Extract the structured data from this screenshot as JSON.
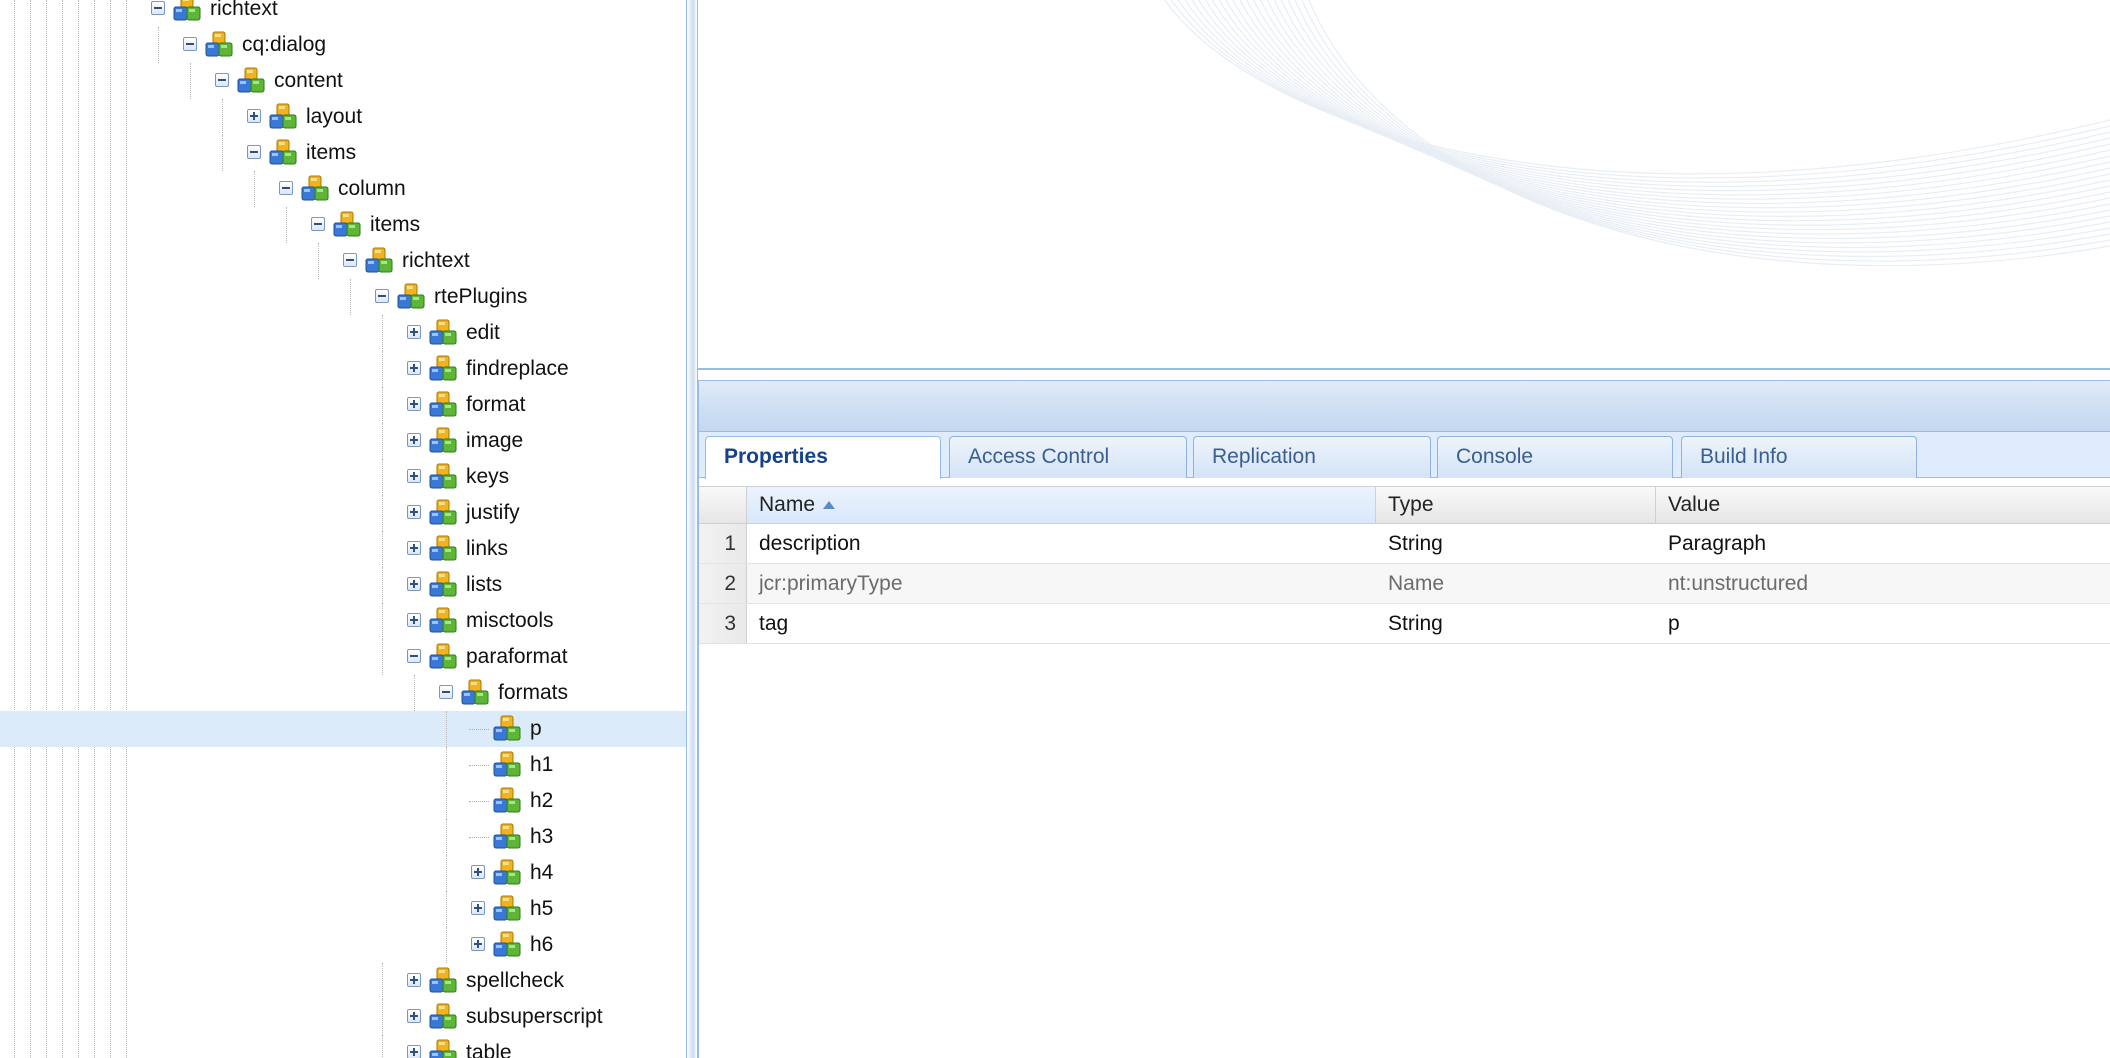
{
  "tree": {
    "nodes": [
      {
        "label": "richtext",
        "level": 0,
        "toggle": "minus",
        "selected": false
      },
      {
        "label": "cq:dialog",
        "level": 1,
        "toggle": "minus",
        "selected": false
      },
      {
        "label": "content",
        "level": 2,
        "toggle": "minus",
        "selected": false
      },
      {
        "label": "layout",
        "level": 3,
        "toggle": "plus",
        "selected": false
      },
      {
        "label": "items",
        "level": 3,
        "toggle": "minus",
        "selected": false
      },
      {
        "label": "column",
        "level": 4,
        "toggle": "minus",
        "selected": false
      },
      {
        "label": "items",
        "level": 5,
        "toggle": "minus",
        "selected": false
      },
      {
        "label": "richtext",
        "level": 6,
        "toggle": "minus",
        "selected": false
      },
      {
        "label": "rtePlugins",
        "level": 7,
        "toggle": "minus",
        "selected": false
      },
      {
        "label": "edit",
        "level": 8,
        "toggle": "plus",
        "selected": false
      },
      {
        "label": "findreplace",
        "level": 8,
        "toggle": "plus",
        "selected": false
      },
      {
        "label": "format",
        "level": 8,
        "toggle": "plus",
        "selected": false
      },
      {
        "label": "image",
        "level": 8,
        "toggle": "plus",
        "selected": false
      },
      {
        "label": "keys",
        "level": 8,
        "toggle": "plus",
        "selected": false
      },
      {
        "label": "justify",
        "level": 8,
        "toggle": "plus",
        "selected": false
      },
      {
        "label": "links",
        "level": 8,
        "toggle": "plus",
        "selected": false
      },
      {
        "label": "lists",
        "level": 8,
        "toggle": "plus",
        "selected": false
      },
      {
        "label": "misctools",
        "level": 8,
        "toggle": "plus",
        "selected": false
      },
      {
        "label": "paraformat",
        "level": 8,
        "toggle": "minus",
        "selected": false
      },
      {
        "label": "formats",
        "level": 9,
        "toggle": "minus",
        "selected": false
      },
      {
        "label": "p",
        "level": 10,
        "toggle": "none",
        "selected": true
      },
      {
        "label": "h1",
        "level": 10,
        "toggle": "none",
        "selected": false
      },
      {
        "label": "h2",
        "level": 10,
        "toggle": "none",
        "selected": false
      },
      {
        "label": "h3",
        "level": 10,
        "toggle": "none",
        "selected": false
      },
      {
        "label": "h4",
        "level": 10,
        "toggle": "plus",
        "selected": false
      },
      {
        "label": "h5",
        "level": 10,
        "toggle": "plus",
        "selected": false
      },
      {
        "label": "h6",
        "level": 10,
        "toggle": "plus",
        "selected": false
      },
      {
        "label": "spellcheck",
        "level": 8,
        "toggle": "plus",
        "selected": false
      },
      {
        "label": "subsuperscript",
        "level": 8,
        "toggle": "plus",
        "selected": false
      },
      {
        "label": "table",
        "level": 8,
        "toggle": "plus",
        "selected": false
      }
    ]
  },
  "tabs": [
    {
      "label": "Properties",
      "active": true
    },
    {
      "label": "Access Control",
      "active": false
    },
    {
      "label": "Replication",
      "active": false
    },
    {
      "label": "Console",
      "active": false
    },
    {
      "label": "Build Info",
      "active": false
    }
  ],
  "grid": {
    "columns": [
      "Name",
      "Type",
      "Value"
    ],
    "sorted_column": "Name",
    "sort_direction": "ascending",
    "rows": [
      {
        "num": "1",
        "name": "description",
        "type": "String",
        "value": "Paragraph",
        "dim": false
      },
      {
        "num": "2",
        "name": "jcr:primaryType",
        "type": "Name",
        "value": "nt:unstructured",
        "dim": true
      },
      {
        "num": "3",
        "name": "tag",
        "type": "String",
        "value": "p",
        "dim": false
      }
    ]
  },
  "colors": {
    "selection": "#dcebfa",
    "panel_border": "#99bbe8",
    "active_tab_text": "#15428b"
  },
  "icons": {
    "node": "node-cube-icon",
    "expand": "expand-plus-icon",
    "collapse": "collapse-minus-icon",
    "sort": "sort-ascending-icon"
  }
}
